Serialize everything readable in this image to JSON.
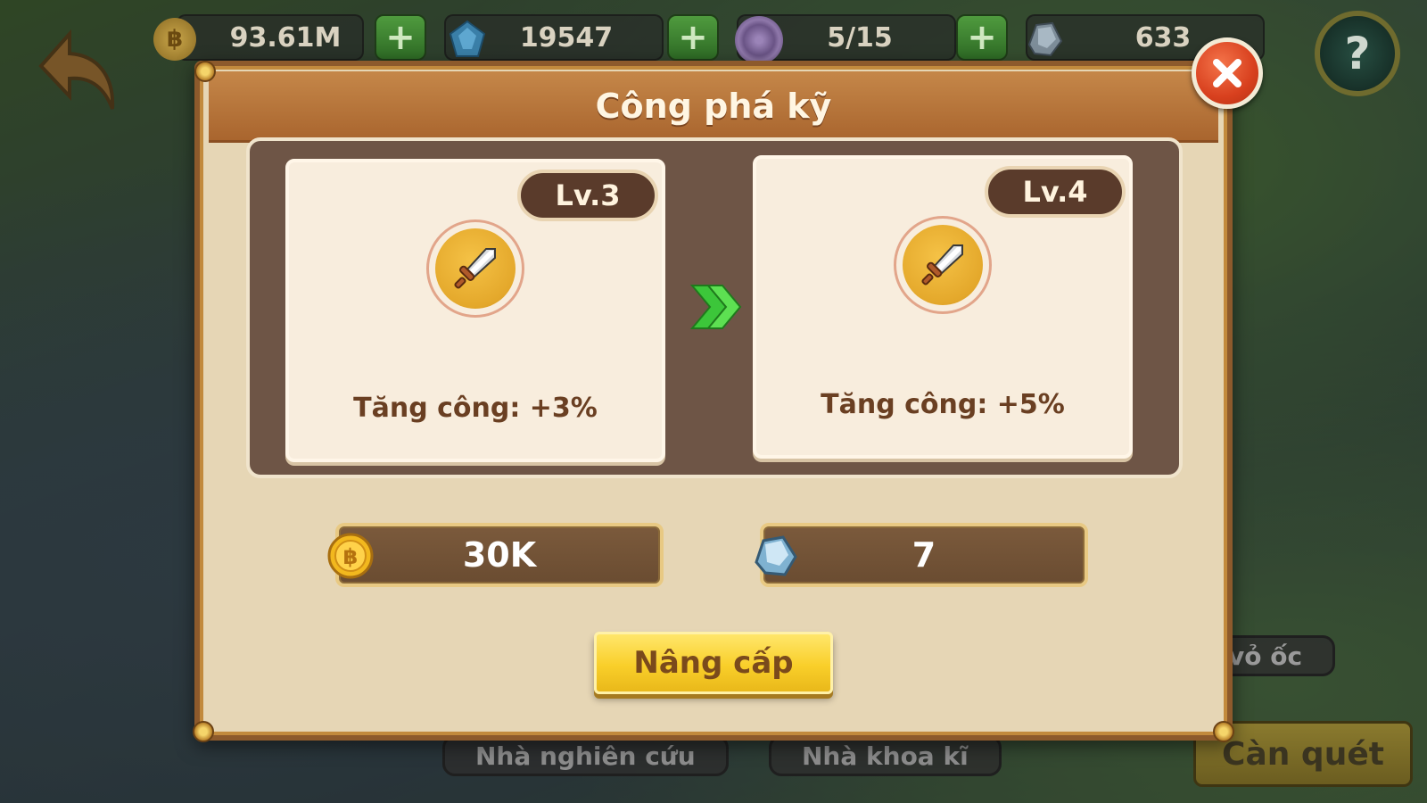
{
  "hud": {
    "gold": "93.61M",
    "gems": "19547",
    "energy": "5/15",
    "crystals": "633"
  },
  "background": {
    "label_research": "Nhà nghiên cứu",
    "label_tech": "Nhà khoa kĩ",
    "label_shell": "vỏ ốc",
    "sweep_button": "Càn quét"
  },
  "modal": {
    "title": "Công phá kỹ",
    "current": {
      "level": "Lv.3",
      "stat": "Tăng công: +3%",
      "icon": "sword-icon"
    },
    "next": {
      "level": "Lv.4",
      "stat": "Tăng công: +5%",
      "icon": "sword-icon"
    },
    "cost_gold": "30K",
    "cost_crystal": "7",
    "upgrade_button": "Nâng cấp"
  },
  "colors": {
    "header": "#b06c33",
    "upgrade": "#f9cf2a",
    "close": "#d8401e",
    "arrow": "#3cc63a"
  }
}
